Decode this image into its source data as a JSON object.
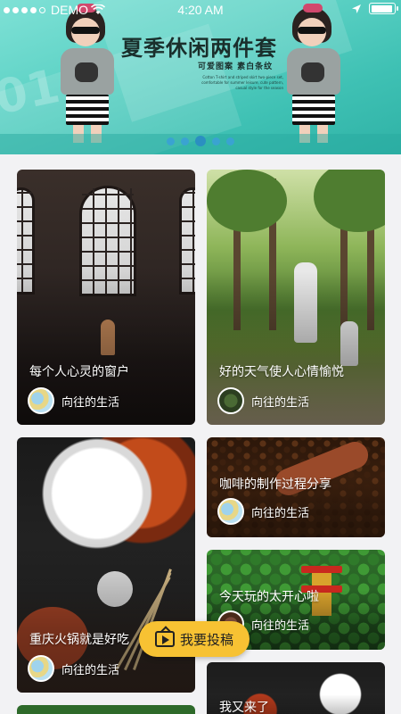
{
  "status_bar": {
    "carrier": "DEMO",
    "time": "4:20 AM"
  },
  "banner": {
    "title": "夏季休闲两件套",
    "subtitle": "可爱图案  素白条纹",
    "bg_text": "016",
    "description": "Cotton T-shirt and striped skirt two-piece set, comfortable for summer leisure, cute pattern, casual style for the season",
    "page_count": 5,
    "active_page": 3
  },
  "feed": {
    "cards": [
      {
        "title": "每个人心灵的窗户",
        "author": "向往的生活"
      },
      {
        "title": "好的天气使人心情愉悦",
        "author": "向往的生活"
      },
      {
        "title": "重庆火锅就是好吃",
        "author": "向往的生活"
      },
      {
        "title": "咖啡的制作过程分享",
        "author": "向往的生活"
      },
      {
        "title": "今天玩的太开心啦",
        "author": "向往的生活"
      },
      {
        "title": "我又来了",
        "author": ""
      }
    ]
  },
  "fab": {
    "label": "我要投稿",
    "icon": "tv-play-icon"
  },
  "colors": {
    "banner": "#5fd3c6",
    "fab": "#f7c233",
    "pager": "#2b8fc1"
  }
}
